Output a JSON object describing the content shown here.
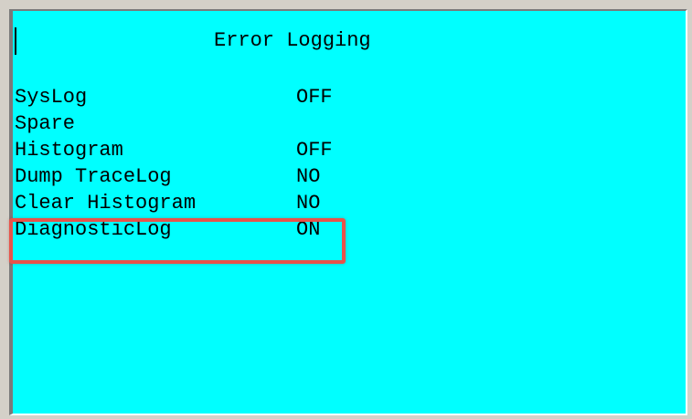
{
  "screen": {
    "title": "Error Logging",
    "background_color": "#00ffff",
    "highlight_color": "#e8534a"
  },
  "menu": {
    "items": [
      {
        "label": "SysLog",
        "value": "OFF"
      },
      {
        "label": "Spare",
        "value": ""
      },
      {
        "label": "Histogram",
        "value": "OFF"
      },
      {
        "label": "Dump TraceLog",
        "value": "NO"
      },
      {
        "label": "Clear Histogram",
        "value": "NO"
      },
      {
        "label": "DiagnosticLog",
        "value": "ON"
      }
    ],
    "highlighted_item": "DiagnosticLog"
  }
}
